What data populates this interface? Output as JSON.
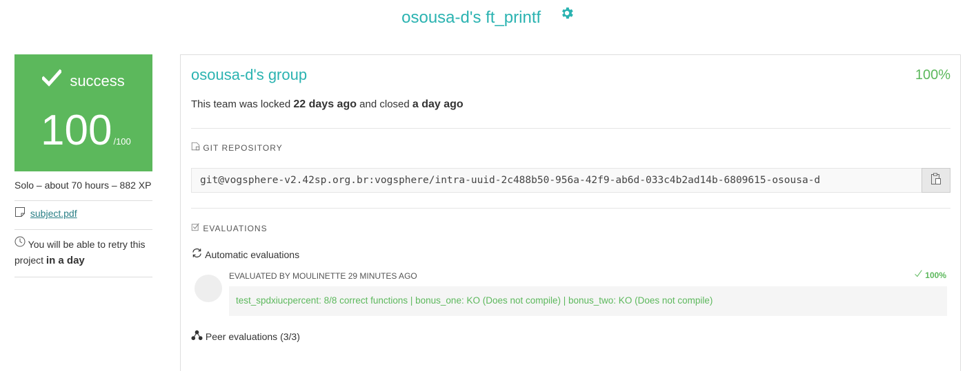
{
  "header": {
    "title": "osousa-d's ft_printf",
    "settings_icon": "gear-icon",
    "accent_color": "#2bb3b1"
  },
  "status_card": {
    "status": "success",
    "check_icon": "check-icon",
    "score": "100",
    "max_score": "/100",
    "color": "#5cb85c"
  },
  "sidebar": {
    "meta": "Solo – about 70 hours – 882 XP",
    "subject_icon": "file-icon",
    "subject_link": "subject.pdf",
    "retry_icon": "clock-icon",
    "retry_prefix": "You will be able to retry this project ",
    "retry_bold": "in a day"
  },
  "group": {
    "name": "osousa-d's group",
    "percent": "100%",
    "locked_prefix": "This team was locked ",
    "locked_time": "22 days ago",
    "closed_prefix": " and closed ",
    "closed_time": "a day ago"
  },
  "git": {
    "label": "GIT REPOSITORY",
    "label_icon": "file-icon",
    "url": "git@vogsphere-v2.42sp.org.br:vogsphere/intra-uuid-2c488b50-956a-42f9-ab6d-033c4b2ad14b-6809615-osousa-d",
    "copy_icon": "clipboard-icon"
  },
  "evaluations": {
    "label": "EVALUATIONS",
    "label_icon": "checkbox-icon",
    "automatic_label": "Automatic evaluations",
    "automatic_icon": "refresh-icon",
    "evaluated_by": "EVALUATED BY MOULINETTE 29 MINUTES AGO",
    "score": "100%",
    "result": "test_spdxiucpercent: 8/8 correct functions | bonus_one: KO (Does not compile) | bonus_two: KO (Does not compile)",
    "peer_label": "Peer evaluations (3/3)",
    "peer_icon": "network-icon"
  }
}
